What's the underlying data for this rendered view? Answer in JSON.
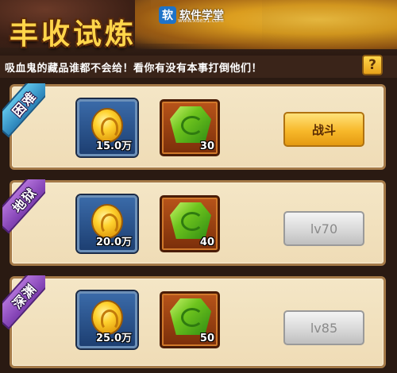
{
  "header": {
    "title": "丰收试炼",
    "subtitle": "吸血鬼的藏品谁都不会给！看你有没有本事打倒他们！",
    "help_label": "?"
  },
  "watermark": {
    "logo": "软",
    "text": "软件学堂",
    "url": "www.xue51.com"
  },
  "levels": [
    {
      "tag": "困难",
      "tag_color": "#3a9ed0",
      "coin_amount": "15.0万",
      "gem_amount": "30",
      "button_label": "战斗",
      "button_state": "active"
    },
    {
      "tag": "地狱",
      "tag_color": "#8a4bc0",
      "coin_amount": "20.0万",
      "gem_amount": "40",
      "button_label": "lv70",
      "button_state": "locked"
    },
    {
      "tag": "深渊",
      "tag_color": "#8a4bc0",
      "coin_amount": "25.0万",
      "gem_amount": "50",
      "button_label": "lv85",
      "button_state": "locked"
    }
  ],
  "icons": {
    "coin": "gold-coin-icon",
    "gem": "green-gem-icon"
  }
}
